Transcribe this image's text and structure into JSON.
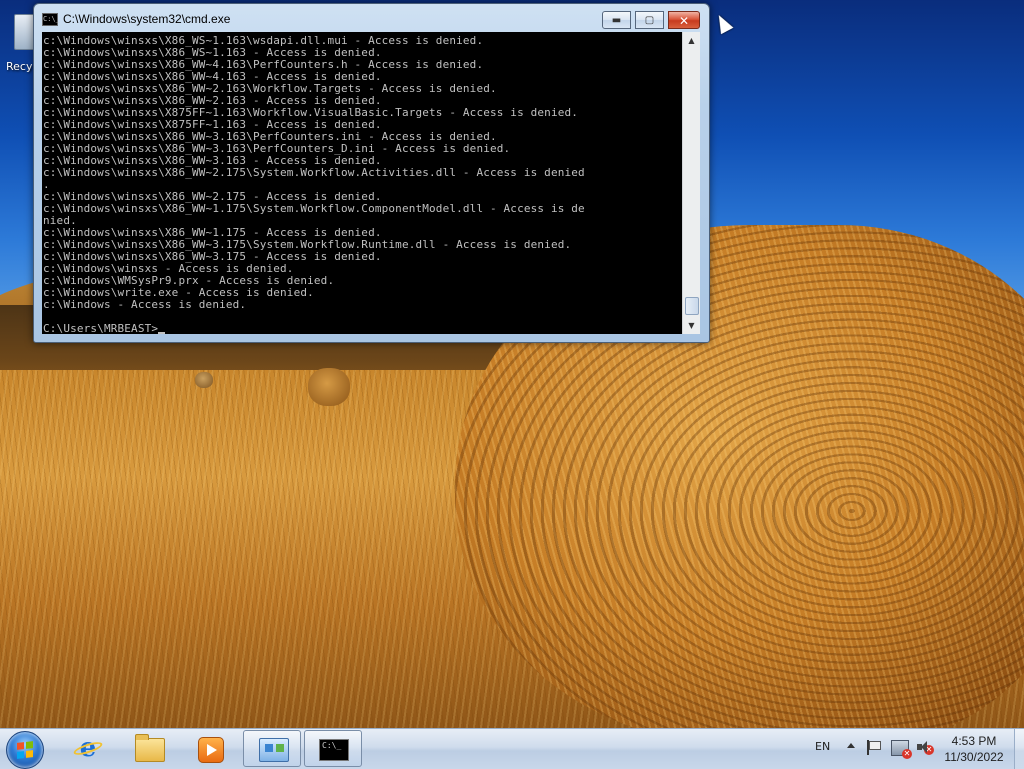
{
  "desktop": {
    "recycle_bin_label": "Recy"
  },
  "window": {
    "title": "C:\\Windows\\system32\\cmd.exe",
    "minimize_glyph": "▬",
    "maximize_glyph": "▢",
    "close_glyph": "✕",
    "icon_text": "C:\\_"
  },
  "console": {
    "lines": [
      "c:\\Windows\\winsxs\\X86_WS~1.163\\wsdapi.dll.mui - Access is denied.",
      "c:\\Windows\\winsxs\\X86_WS~1.163 - Access is denied.",
      "c:\\Windows\\winsxs\\X86_WW~4.163\\PerfCounters.h - Access is denied.",
      "c:\\Windows\\winsxs\\X86_WW~4.163 - Access is denied.",
      "c:\\Windows\\winsxs\\X86_WW~2.163\\Workflow.Targets - Access is denied.",
      "c:\\Windows\\winsxs\\X86_WW~2.163 - Access is denied.",
      "c:\\Windows\\winsxs\\X875FF~1.163\\Workflow.VisualBasic.Targets - Access is denied.",
      "c:\\Windows\\winsxs\\X875FF~1.163 - Access is denied.",
      "c:\\Windows\\winsxs\\X86_WW~3.163\\PerfCounters.ini - Access is denied.",
      "c:\\Windows\\winsxs\\X86_WW~3.163\\PerfCounters_D.ini - Access is denied.",
      "c:\\Windows\\winsxs\\X86_WW~3.163 - Access is denied.",
      "c:\\Windows\\winsxs\\X86_WW~2.175\\System.Workflow.Activities.dll - Access is denied",
      ".",
      "c:\\Windows\\winsxs\\X86_WW~2.175 - Access is denied.",
      "c:\\Windows\\winsxs\\X86_WW~1.175\\System.Workflow.ComponentModel.dll - Access is de",
      "nied.",
      "c:\\Windows\\winsxs\\X86_WW~1.175 - Access is denied.",
      "c:\\Windows\\winsxs\\X86_WW~3.175\\System.Workflow.Runtime.dll - Access is denied.",
      "c:\\Windows\\winsxs\\X86_WW~3.175 - Access is denied.",
      "c:\\Windows\\winsxs - Access is denied.",
      "c:\\Windows\\WMSysPr9.prx - Access is denied.",
      "c:\\Windows\\write.exe - Access is denied.",
      "c:\\Windows - Access is denied.",
      ""
    ],
    "prompt": "C:\\Users\\MRBEAST>",
    "scroll_up_glyph": "▲",
    "scroll_down_glyph": "▼"
  },
  "taskbar": {
    "items": [
      {
        "name": "Internet Explorer",
        "icon": "internet-explorer-icon"
      },
      {
        "name": "Windows Explorer",
        "icon": "folder-icon"
      },
      {
        "name": "Windows Media Player",
        "icon": "media-player-icon"
      },
      {
        "name": "Control Panel",
        "icon": "control-panel-icon"
      },
      {
        "name": "Command Prompt",
        "icon": "cmd-icon"
      }
    ],
    "cmd_icon_text": "C:\\_",
    "tray": {
      "language": "EN",
      "network_error_glyph": "✕",
      "volume_error_glyph": "✕",
      "time": "4:53 PM",
      "date": "11/30/2022"
    }
  }
}
